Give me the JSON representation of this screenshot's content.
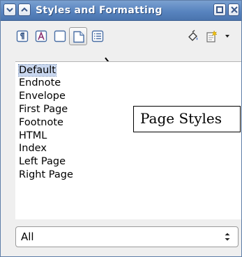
{
  "window": {
    "title": "Styles and Formatting"
  },
  "toolbar": {
    "icons": [
      "paragraph-styles-icon",
      "character-styles-icon",
      "frame-styles-icon",
      "page-styles-icon",
      "list-styles-icon",
      "fill-format-mode-icon",
      "new-style-from-selection-icon",
      "dropdown-arrow-icon"
    ],
    "active_tool": "page-styles-icon"
  },
  "callout": {
    "text": "Page Styles"
  },
  "styles_list": {
    "items": [
      "Default",
      "Endnote",
      "Envelope",
      "First Page",
      "Footnote",
      "HTML",
      "Index",
      "Left Page",
      "Right Page"
    ],
    "selected": "Default"
  },
  "filter": {
    "selected": "All"
  },
  "colors": {
    "titlebar": "#5884bf",
    "selection": "#c9d7ef"
  }
}
